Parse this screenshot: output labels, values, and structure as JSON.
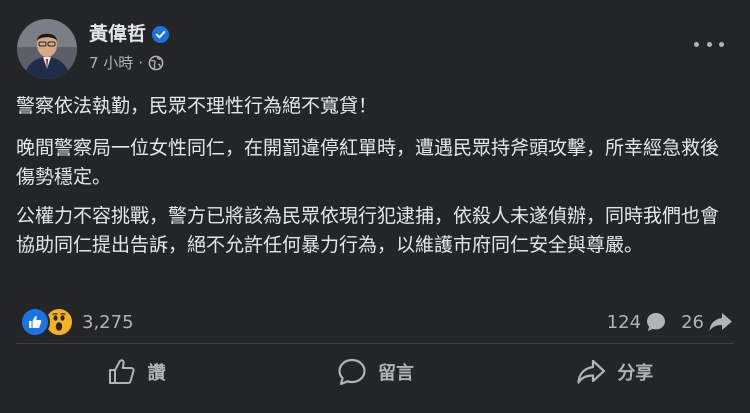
{
  "post": {
    "author": "黃偉哲",
    "timestamp": "7 小時",
    "separator": "·",
    "paragraphs": [
      "警察依法執勤，民眾不理性行為絕不寬貸！",
      "晚間警察局一位女性同仁，在開罰違停紅單時，遭遇民眾持斧頭攻擊，所幸經急救後傷勢穩定。",
      "公權力不容挑戰，警方已將該為民眾依現行犯逮捕，依殺人未遂偵辦，同時我們也會協助同仁提出告訴，絕不允許任何暴力行為，以維護市府同仁安全與尊嚴。"
    ]
  },
  "reactions": {
    "types": [
      "like-icon",
      "wow-icon"
    ],
    "count": "3,275"
  },
  "stats": {
    "comments": "124",
    "shares": "26"
  },
  "actions": {
    "like": "讚",
    "comment": "留言",
    "share": "分享"
  },
  "colors": {
    "background": "#242526",
    "primary_text": "#e4e6eb",
    "secondary_text": "#b0b3b8",
    "like_blue": "#1b74e4",
    "wow_yellow": "#f7b125",
    "divider": "#3e4042"
  }
}
